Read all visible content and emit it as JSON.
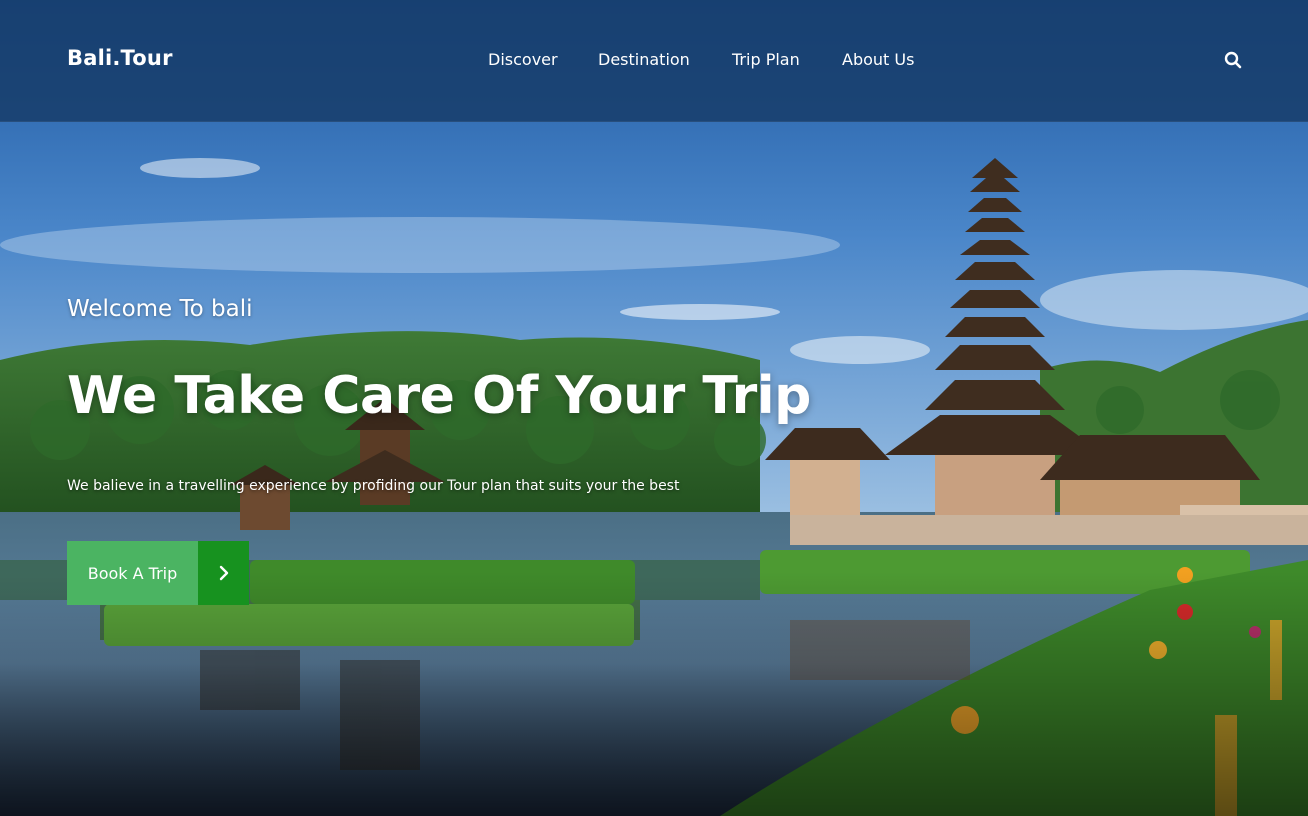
{
  "brand": {
    "name": "Bali.Tour"
  },
  "nav": {
    "items": [
      {
        "label": "Discover"
      },
      {
        "label": "Destination"
      },
      {
        "label": "Trip Plan"
      },
      {
        "label": "About Us"
      }
    ],
    "search_icon": "search-icon"
  },
  "hero": {
    "welcome": "Welcome To bali",
    "headline": "We Take Care Of Your Trip",
    "subline": "We balieve in a travelling experience by profiding our Tour plan that suits your the best",
    "cta_label": "Book A Trip",
    "cta_icon": "chevron-right-icon",
    "background_image": "bali-temple-lake-photo"
  },
  "colors": {
    "nav_background": "#163a66",
    "cta_primary": "#4bb462",
    "cta_secondary": "#17921f",
    "text": "#ffffff"
  }
}
